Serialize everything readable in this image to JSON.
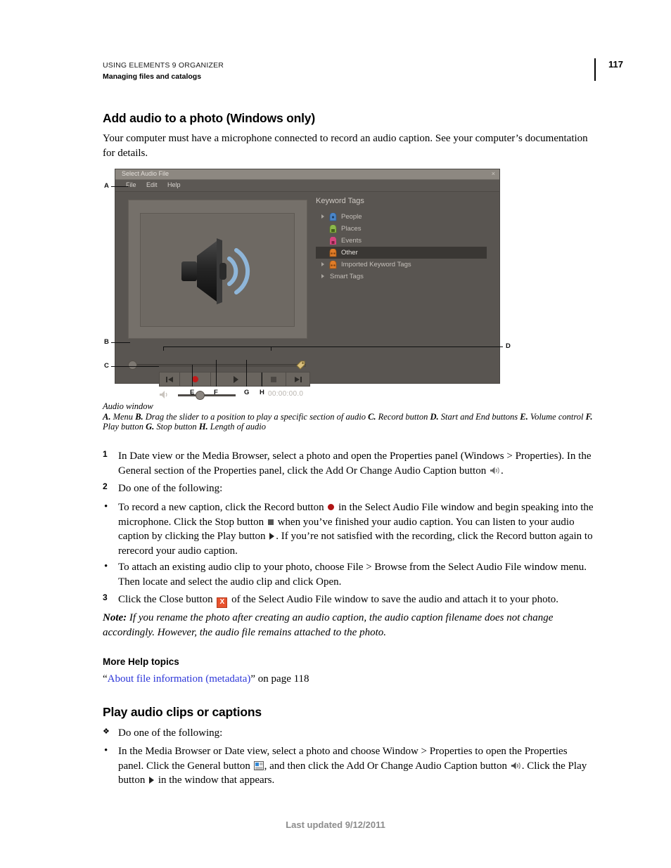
{
  "header": {
    "line1": "USING ELEMENTS 9 ORGANIZER",
    "line2": "Managing files and catalogs",
    "page_number": "117"
  },
  "sections": {
    "heading1": "Add audio to a photo (Windows only)",
    "intro": "Your computer must have a microphone connected to record an audio caption. See your computer’s documentation for details.",
    "more_help_heading": "More Help topics",
    "xref_link": "About file information (metadata)",
    "xref_suffix": " on page 118",
    "heading2": "Play audio clips or captions"
  },
  "steps": {
    "s1_num": "1",
    "s1_a": "In Date view or the Media Browser, select a photo and open the Properties panel (Windows > Properties). In the General section of the Properties panel, click the Add Or Change Audio Caption button ",
    "s1_b": ".",
    "s2_num": "2",
    "s2_text": "Do one of the following:",
    "b1_a": "To record a new caption, click the Record button ",
    "b1_b": " in the Select Audio File window and begin speaking into the microphone. Click the Stop button ",
    "b1_c": " when you’ve finished your audio caption. You can listen to your audio caption by clicking the Play button ",
    "b1_d": ". If you’re not satisfied with the recording, click the Record button again to rerecord your audio caption.",
    "b2_text": "To attach an existing audio clip to your photo, choose File > Browse from the Select Audio File window menu. Then locate and select the audio clip and click Open.",
    "s3_num": "3",
    "s3_a": "Click the Close button ",
    "s3_close_glyph": "X",
    "s3_b": " of the Select Audio File window to save the audio and attach it to your photo.",
    "note_label": "Note:",
    "note_text": " If you rename the photo after creating an audio caption, the audio caption filename does not change accordingly. However, the audio file remains attached to the photo.",
    "play_intro": "Do one of the following:",
    "play_b1_a": "In the Media Browser or Date view, select a photo and choose Window > Properties to open the Properties panel. Click the General button ",
    "play_b1_b": ", and then click the Add Or Change Audio Caption button ",
    "play_b1_c": ". Click the Play button ",
    "play_b1_d": " in the window that appears."
  },
  "figure": {
    "dialog_title": "Select Audio File",
    "close_glyph": "×",
    "menu": [
      "File",
      "Edit",
      "Help"
    ],
    "keyword_tags_title": "Keyword Tags",
    "keyword_tags": [
      {
        "label": "People",
        "icon": "tag-icon-blue",
        "color": "#4b86c8",
        "arrow": true,
        "selected": false
      },
      {
        "label": "Places",
        "icon": "tag-icon-green",
        "color": "#8cb84b",
        "arrow": false,
        "selected": false
      },
      {
        "label": "Events",
        "icon": "tag-icon-pink",
        "color": "#d6457e",
        "arrow": false,
        "selected": false
      },
      {
        "label": "Other",
        "icon": "tag-icon-orange",
        "color": "#e07c28",
        "arrow": false,
        "selected": true
      },
      {
        "label": "Imported Keyword Tags",
        "icon": "tag-icon-orange",
        "color": "#e07c28",
        "arrow": true,
        "selected": false
      },
      {
        "label": "Smart Tags",
        "icon": "none",
        "color": "#a9a49e",
        "arrow": true,
        "selected": false
      }
    ],
    "timecode": "00:00:00.0",
    "transport_buttons": [
      "skip-to-start",
      "record",
      "play",
      "stop",
      "skip-to-end"
    ],
    "callouts": [
      {
        "letter": "A",
        "target": "menu-bar"
      },
      {
        "letter": "B",
        "target": "scrub-slider"
      },
      {
        "letter": "C",
        "target": "volume-control"
      },
      {
        "letter": "D",
        "target": "start-and-end-buttons"
      },
      {
        "letter": "E",
        "target": "volume-slider-knob"
      },
      {
        "letter": "F",
        "target": "play-button"
      },
      {
        "letter": "G",
        "target": "stop-button"
      },
      {
        "letter": "H",
        "target": "length-of-audio"
      }
    ],
    "caption_title": "Audio window",
    "caption_legend_a": "A.",
    "caption_legend_a_t": " Menu ",
    "caption_legend_b": "B.",
    "caption_legend_b_t": " Drag the slider to a position to play a specific section of audio ",
    "caption_legend_c": "C.",
    "caption_legend_c_t": " Record button ",
    "caption_legend_d": "D.",
    "caption_legend_d_t": " Start and End buttons ",
    "caption_legend_e": "E.",
    "caption_legend_e_t": " Volume control",
    "caption_legend_f": "F.",
    "caption_legend_f_t": " Play button ",
    "caption_legend_g": "G.",
    "caption_legend_g_t": " Stop button ",
    "caption_legend_h": "H.",
    "caption_legend_h_t": " Length of audio"
  },
  "footer": {
    "text": "Last updated 9/12/2011"
  },
  "colors": {
    "link": "#2b35d8",
    "dialog_bg": "#595551",
    "title_bar": "#8d8881",
    "record_red": "#c11a1a",
    "close_orange": "#e8522e",
    "footer_gray": "#8c8c8c"
  }
}
